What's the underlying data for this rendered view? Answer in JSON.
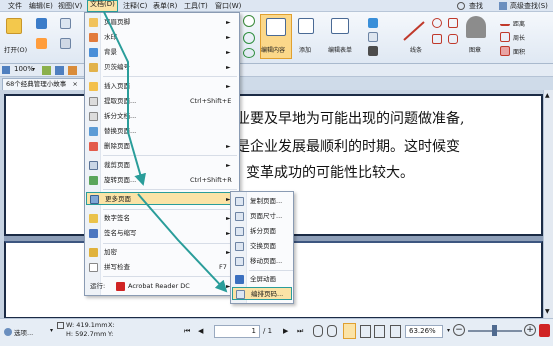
{
  "menubar": {
    "items": [
      "文件",
      "编辑(E)",
      "视图(V)",
      "文档(D)",
      "注释(C)",
      "表单(R)",
      "工具(T)",
      "窗口(W)"
    ],
    "right_items": [
      "查找",
      "高级查找(S)"
    ]
  },
  "ribbon": {
    "open_label": "打开(O)",
    "edit_content_label": "编辑内容",
    "add_label": "添加",
    "edit_form_label": "编辑表单",
    "line_label": "线条",
    "stamp_label": "图章",
    "distance_label": "距离",
    "perimeter_label": "周长",
    "area_label": "面积"
  },
  "viewbar": {
    "zoom": "100%"
  },
  "tab": {
    "title": "68个经典管理小故事"
  },
  "document": {
    "line1": "业要及早地为可能出现的问题做准备,",
    "line2": "是企业发展最顺利的时期。这时候变",
    "line3": "变革成功的可能性比较大。"
  },
  "doc_menu": {
    "items": [
      {
        "label": "页眉页脚",
        "arrow": "►"
      },
      {
        "label": "水印",
        "arrow": "►"
      },
      {
        "label": "背景",
        "arrow": "►"
      },
      {
        "label": "贝茨编号",
        "arrow": "►"
      },
      {
        "label": "插入页面",
        "arrow": "►"
      },
      {
        "label": "提取页面...",
        "shortcut": "Ctrl+Shift+E"
      },
      {
        "label": "拆分文档..."
      },
      {
        "label": "替换页面..."
      },
      {
        "label": "删除页面",
        "arrow": "►"
      },
      {
        "label": "裁剪页面",
        "arrow": "►"
      },
      {
        "label": "旋转页面...",
        "shortcut": "Ctrl+Shift+R"
      },
      {
        "label": "更多页面",
        "arrow": "►"
      },
      {
        "label": "数字签名",
        "arrow": "►"
      },
      {
        "label": "签名与缩写",
        "arrow": "►"
      },
      {
        "label": "加密",
        "arrow": "►"
      },
      {
        "label": "拼写检查",
        "shortcut": "F7"
      },
      {
        "label": "运行:",
        "app": "Acrobat Reader DC",
        "arrow": "►"
      }
    ]
  },
  "sub_menu": {
    "items": [
      "复制页面...",
      "页面尺寸...",
      "拆分页面",
      "交换页面",
      "移动页面...",
      "全屏动画",
      "编排页码..."
    ]
  },
  "statusbar": {
    "options_label": "选项...",
    "width": "W: 419.1mm",
    "height": "H: 592.7mm",
    "x_label": "X:",
    "y_label": "Y:",
    "page_field": "1",
    "page_total": "/ 1",
    "zoom": "63.26%"
  },
  "colors": {
    "accent_teal": "#2a9d9a",
    "highlight": "#fbe3a6",
    "page_border": "#1b2b45",
    "pdf_red": "#d02424"
  }
}
